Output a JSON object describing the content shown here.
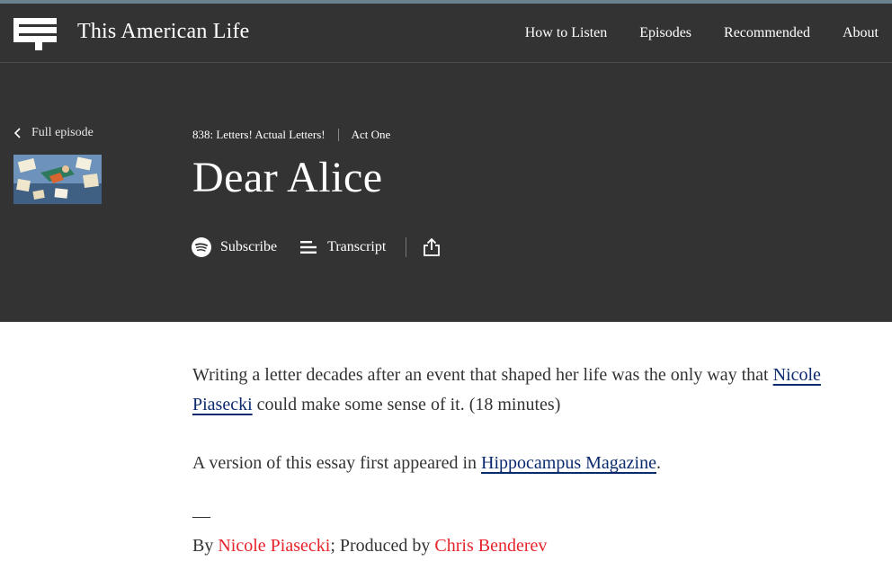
{
  "site": {
    "name": "This American Life",
    "nav": [
      "How to Listen",
      "Episodes",
      "Recommended",
      "About"
    ]
  },
  "sidebar": {
    "back_label": "Full episode"
  },
  "breadcrumb": {
    "episode": "838: Letters! Actual Letters!",
    "act": "Act One"
  },
  "page": {
    "title": "Dear Alice"
  },
  "actions": {
    "subscribe": "Subscribe",
    "transcript": "Transcript"
  },
  "body": {
    "p1_text_a": "Writing a letter decades after an event that shaped her life was the only way that ",
    "p1_link": "Nicole Piasecki",
    "p1_text_b": " could make some sense of it. (18 minutes)",
    "p2_text_a": "A version of this essay first appeared in ",
    "p2_link": "Hippocampus Magazine",
    "p2_text_b": ".",
    "dash": "—",
    "credits_by": "By ",
    "credits_author": "Nicole Piasecki",
    "credits_mid": "; Produced by ",
    "credits_producer": "Chris Benderev"
  },
  "colors": {
    "header_bg": "#333333",
    "link_blue": "#0b2a6e",
    "credit_red": "#e5242b"
  }
}
